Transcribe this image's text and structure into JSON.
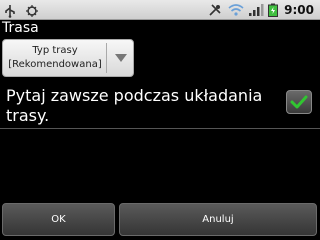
{
  "status": {
    "time": "9:00",
    "icons": [
      "usb-icon",
      "debug-icon",
      "gps-icon",
      "wifi-icon",
      "signal-icon",
      "battery-icon"
    ]
  },
  "dialog": {
    "title": "Trasa",
    "dropdown": {
      "line1": "Typ trasy",
      "line2": "[Rekomendowana]"
    },
    "option_label": "Pytaj zawsze podczas układania trasy.",
    "checkbox_checked": true,
    "ok_label": "OK",
    "cancel_label": "Anuluj"
  },
  "colors": {
    "check": "#31c531"
  }
}
